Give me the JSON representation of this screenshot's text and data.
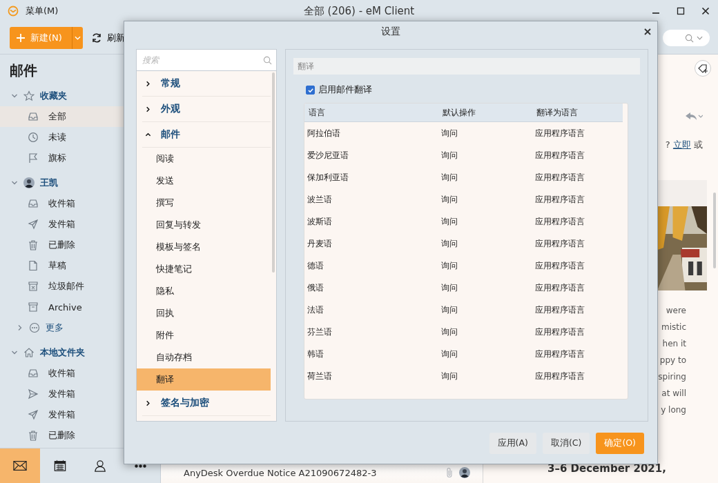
{
  "app": {
    "menu_label": "菜单(M)",
    "title": "全部 (206) - eM Client"
  },
  "toolbar": {
    "new_button": "新建(N)",
    "refresh_button": "刷新"
  },
  "sidebar": {
    "heading": "邮件",
    "groups": [
      {
        "label": "收藏夹",
        "kind": "favorites",
        "expanded": true,
        "items": [
          {
            "label": "全部",
            "kind": "inbox",
            "selected": true
          },
          {
            "label": "未读",
            "kind": "clock",
            "selected": false
          },
          {
            "label": "旗标",
            "kind": "flag",
            "selected": false
          }
        ]
      },
      {
        "label": "王凯",
        "kind": "account",
        "expanded": true,
        "items": [
          {
            "label": "收件箱",
            "kind": "inbox",
            "selected": false
          },
          {
            "label": "发件箱",
            "kind": "sent",
            "selected": false
          },
          {
            "label": "已删除",
            "kind": "trash",
            "selected": false
          },
          {
            "label": "草稿",
            "kind": "draft",
            "selected": false
          },
          {
            "label": "垃圾邮件",
            "kind": "junk",
            "selected": false
          },
          {
            "label": "Archive",
            "kind": "archive",
            "selected": false
          }
        ],
        "more": {
          "label": "更多",
          "expanded": false
        }
      },
      {
        "label": "本地文件夹",
        "kind": "local",
        "expanded": true,
        "items": [
          {
            "label": "收件箱",
            "kind": "inbox",
            "selected": false
          },
          {
            "label": "发件箱",
            "kind": "outbox",
            "selected": false
          },
          {
            "label": "发件箱",
            "kind": "sent",
            "selected": false
          },
          {
            "label": "已删除",
            "kind": "trash",
            "selected": false
          }
        ]
      }
    ]
  },
  "bottom_nav": [
    {
      "kind": "mail",
      "selected": true
    },
    {
      "kind": "calendar",
      "selected": false
    },
    {
      "kind": "contacts",
      "selected": false
    },
    {
      "kind": "more",
      "selected": false
    }
  ],
  "message_list": {
    "rows": [
      {
        "subject": "AnyDesk Overdue Notice A21090672482-3",
        "attachment": true
      }
    ]
  },
  "reading_pane": {
    "prompt": "?",
    "link": "立即",
    "prompt_after": "或",
    "body_lines": [
      "were",
      "mistic",
      "hen it",
      "ppy to",
      "spiring",
      "at will",
      "y long"
    ],
    "event_date": "3–6 December 2021,"
  },
  "dialog": {
    "title": "设置",
    "search": {
      "placeholder": "搜索"
    },
    "nav": [
      {
        "label": "常规",
        "expanded": false
      },
      {
        "label": "外观",
        "expanded": false
      },
      {
        "label": "邮件",
        "expanded": true,
        "children": [
          {
            "label": "阅读",
            "selected": false
          },
          {
            "label": "发送",
            "selected": false
          },
          {
            "label": "撰写",
            "selected": false
          },
          {
            "label": "回复与转发",
            "selected": false
          },
          {
            "label": "模板与签名",
            "selected": false
          },
          {
            "label": "快捷笔记",
            "selected": false
          },
          {
            "label": "隐私",
            "selected": false
          },
          {
            "label": "回执",
            "selected": false
          },
          {
            "label": "附件",
            "selected": false
          },
          {
            "label": "自动存档",
            "selected": false
          },
          {
            "label": "翻译",
            "selected": true
          }
        ]
      },
      {
        "label": "签名与加密",
        "expanded": false
      }
    ],
    "section_title": "翻译",
    "enable_translation": {
      "label": "启用邮件翻译",
      "checked": true
    },
    "table": {
      "columns": [
        "语言",
        "默认操作",
        "翻译为语言"
      ],
      "rows": [
        [
          "阿拉伯语",
          "询问",
          "应用程序语言"
        ],
        [
          "爱沙尼亚语",
          "询问",
          "应用程序语言"
        ],
        [
          "保加利亚语",
          "询问",
          "应用程序语言"
        ],
        [
          "波兰语",
          "询问",
          "应用程序语言"
        ],
        [
          "波斯语",
          "询问",
          "应用程序语言"
        ],
        [
          "丹麦语",
          "询问",
          "应用程序语言"
        ],
        [
          "德语",
          "询问",
          "应用程序语言"
        ],
        [
          "俄语",
          "询问",
          "应用程序语言"
        ],
        [
          "法语",
          "询问",
          "应用程序语言"
        ],
        [
          "芬兰语",
          "询问",
          "应用程序语言"
        ],
        [
          "韩语",
          "询问",
          "应用程序语言"
        ],
        [
          "荷兰语",
          "询问",
          "应用程序语言"
        ]
      ]
    },
    "buttons": [
      {
        "label": "应用(A)",
        "kind": "secondary"
      },
      {
        "label": "取消(C)",
        "kind": "secondary"
      },
      {
        "label": "确定(O)",
        "kind": "primary"
      }
    ]
  }
}
